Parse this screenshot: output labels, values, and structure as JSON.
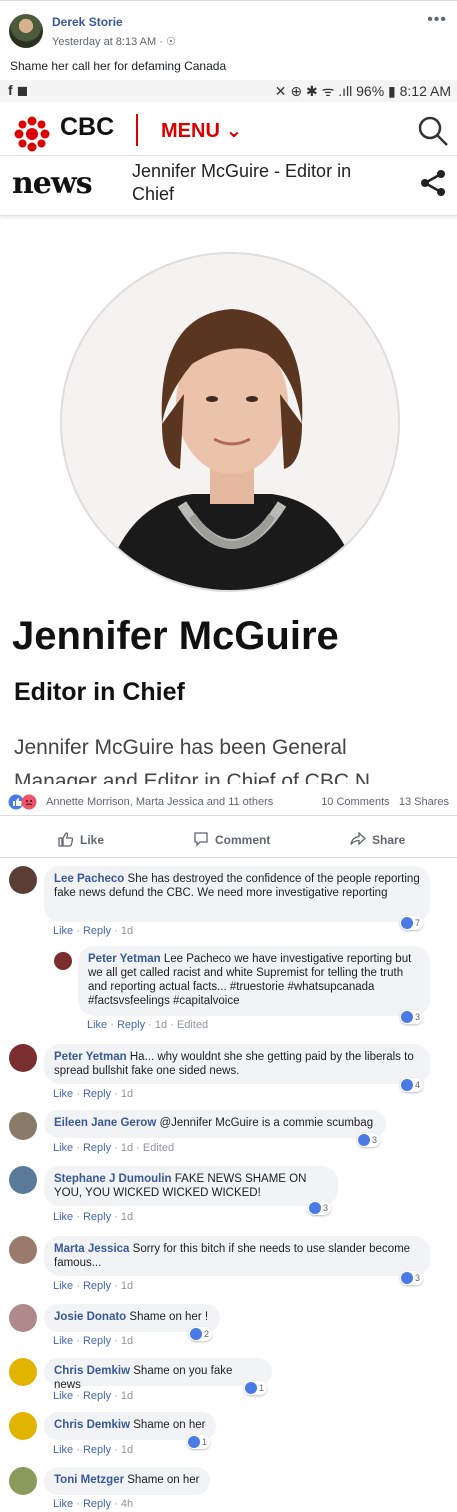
{
  "post": {
    "author": "Derek Storie",
    "time": "Yesterday at 8:13 AM",
    "text": "Shame her call her for defaming Canada"
  },
  "screenshot": {
    "status_left": "f ◼",
    "status_right": "✕ ⊕ ✱ ᯤ .ıll 96% ▮ 8:12 AM",
    "brand": "CBC",
    "menu_label": "MENU ⌄",
    "news_word": "news",
    "page_title": "Jennifer McGuire - Editor in Chief",
    "person_name": "Jennifer McGuire",
    "person_role": "Editor in Chief",
    "bio_line1": "Jennifer McGuire has been General",
    "bio_line2": "Manager and Editor in Chief of CBC N"
  },
  "reactions": {
    "names": "Annette Morrison, Marta Jessica and 11 others",
    "comments": "10 Comments",
    "shares": "13 Shares"
  },
  "actions": {
    "like": "Like",
    "comment": "Comment",
    "share": "Share"
  },
  "comments": [
    {
      "name": "Lee Pacheco",
      "text": "She has destroyed the confidence of the people reporting fake news defund the CBC. We need more investigative reporting",
      "time": "1d",
      "likes": "7",
      "edited": ""
    },
    {
      "name": "Peter Yetman",
      "text": "Lee Pacheco we have investigative reporting but we all get called racist and white Supremist for telling the truth and reporting actual facts... #truestorie #whatsupcanada #factsvsfeelings #capitalvoice",
      "time": "1d",
      "likes": "3",
      "edited": "Edited"
    },
    {
      "name": "Peter Yetman",
      "text": "Ha... why wouldnt she she getting paid by the liberals to spread bullshit fake one sided news.",
      "time": "1d",
      "likes": "4",
      "edited": ""
    },
    {
      "name": "Eileen Jane Gerow",
      "text": "@Jennifer McGuire is a commie scumbag",
      "time": "1d",
      "likes": "3",
      "edited": "Edited"
    },
    {
      "name": "Stephane J Dumoulin",
      "text": "FAKE NEWS SHAME ON YOU, YOU WICKED WICKED WICKED!",
      "time": "1d",
      "likes": "3",
      "edited": ""
    },
    {
      "name": "Marta Jessica",
      "text": "Sorry for this bitch if she needs to use slander become famous...",
      "time": "1d",
      "likes": "3",
      "edited": ""
    },
    {
      "name": "Josie Donato",
      "text": "Shame on her !",
      "time": "1d",
      "likes": "2",
      "edited": ""
    },
    {
      "name": "Chris Demkiw",
      "text": "Shame on you fake news",
      "time": "1d",
      "likes": "1",
      "edited": ""
    },
    {
      "name": "Chris Demkiw",
      "text": "Shame on her",
      "time": "1d",
      "likes": "1",
      "edited": ""
    },
    {
      "name": "Toni Metzger",
      "text": "Shame on her",
      "time": "4h",
      "likes": "",
      "edited": ""
    }
  ],
  "link_labels": {
    "like": "Like",
    "reply": "Reply"
  }
}
